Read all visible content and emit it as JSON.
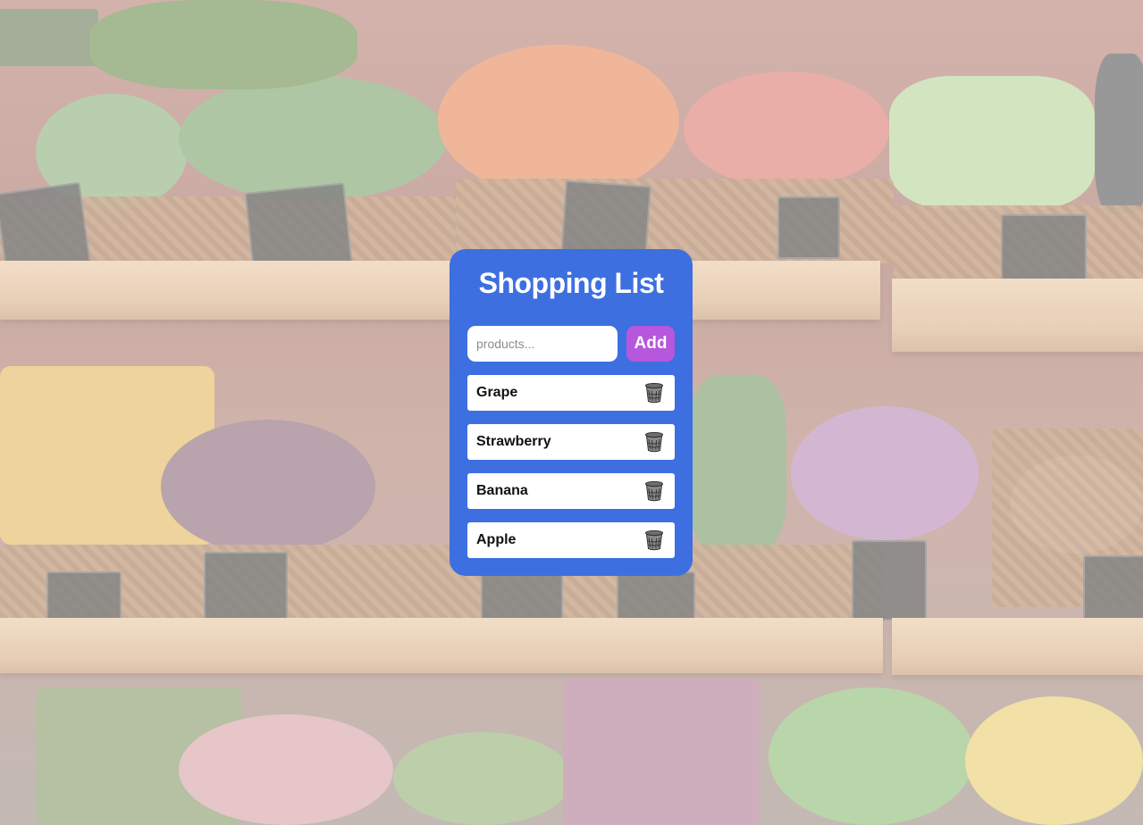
{
  "app": {
    "title": "Shopping List"
  },
  "form": {
    "placeholder": "products...",
    "value": "",
    "add_label": "Add"
  },
  "items": [
    {
      "label": "Grape",
      "delete_icon": "trash-icon"
    },
    {
      "label": "Strawberry",
      "delete_icon": "trash-icon"
    },
    {
      "label": "Banana",
      "delete_icon": "trash-icon"
    },
    {
      "label": "Apple",
      "delete_icon": "trash-icon"
    }
  ],
  "colors": {
    "card_background": "#3d6fe0",
    "add_button": "#b657dd",
    "title_text": "#ffffff",
    "item_background": "#ffffff"
  },
  "background": {
    "description_icon": "market-produce-shelves-image"
  }
}
